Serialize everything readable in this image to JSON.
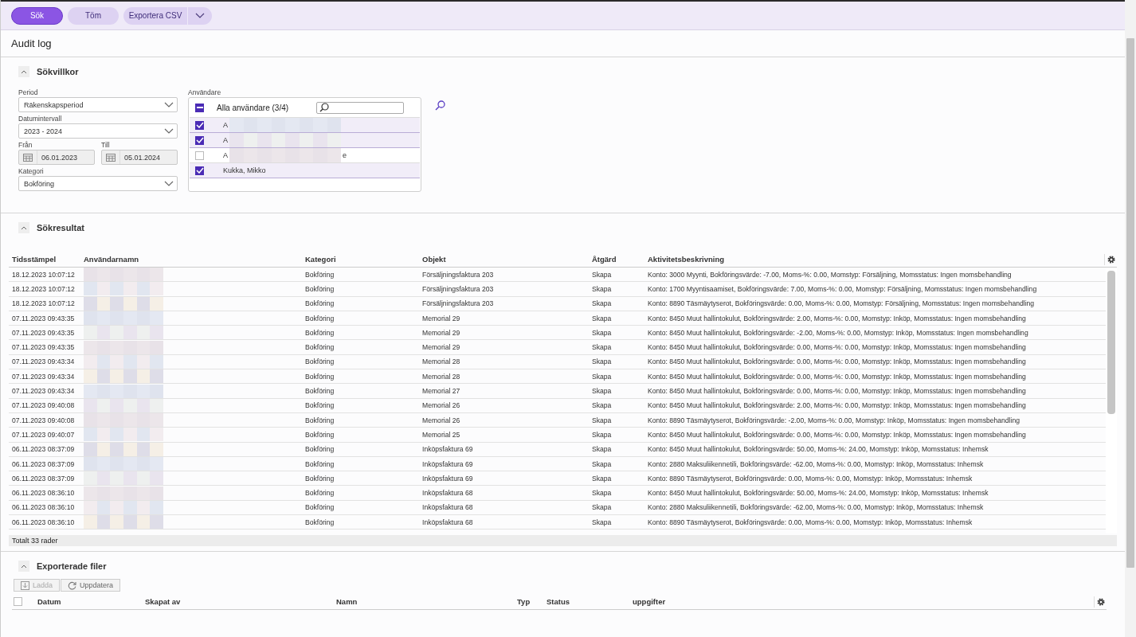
{
  "toolbar": {
    "buttons": [
      {
        "label": "Sök",
        "kind": "primary"
      },
      {
        "label": "Töm",
        "kind": "secondary"
      },
      {
        "label": "Exportera CSV",
        "kind": "split"
      }
    ]
  },
  "page_title": "Audit log",
  "criteria": {
    "title": "Sökvillkor",
    "expanded": true,
    "period": {
      "label": "Period",
      "value": "Räkenskapsperiod"
    },
    "date_range": {
      "label": "Datumintervall",
      "value": "2023 - 2024"
    },
    "from": {
      "label": "Från",
      "value": "06.01.2023"
    },
    "to": {
      "label": "Till",
      "value": "05.01.2024"
    },
    "category": {
      "label": "Kategori",
      "value": "Bokföring"
    },
    "users": {
      "label": "Användare",
      "header": "Alla användare (3/4)",
      "indeterminate": true,
      "items": [
        {
          "label_start": "A",
          "redacted": true,
          "checked": true
        },
        {
          "label_start": "A",
          "redacted": true,
          "checked": true
        },
        {
          "label_start": "A",
          "label_end": "e",
          "redacted": true,
          "checked": false
        },
        {
          "label_start": "Kukka, Mikko",
          "redacted": false,
          "checked": true
        }
      ]
    }
  },
  "results": {
    "title": "Sökresultat",
    "expanded": true,
    "columns": [
      "Tidsstämpel",
      "Användarnamn",
      "Kategori",
      "Objekt",
      "Åtgärd",
      "Aktivitetsbeskrivning"
    ],
    "rows": [
      {
        "timestamp": "18.12.2023 10:07:12",
        "user_redacted": true,
        "category": "Bokföring",
        "object": "Försäljningsfaktura 203",
        "action": "Skapa",
        "description": "Konto: 3000 Myynti, Bokföringsvärde: -7.00, Moms-%: 0.00, Momstyp: Försäljning, Momsstatus: Ingen momsbehandling"
      },
      {
        "timestamp": "18.12.2023 10:07:12",
        "user_redacted": true,
        "category": "Bokföring",
        "object": "Försäljningsfaktura 203",
        "action": "Skapa",
        "description": "Konto: 1700 Myyntisaamiset, Bokföringsvärde: 7.00, Moms-%: 0.00, Momstyp: Försäljning, Momsstatus: Ingen momsbehandling"
      },
      {
        "timestamp": "18.12.2023 10:07:12",
        "user_redacted": true,
        "category": "Bokföring",
        "object": "Försäljningsfaktura 203",
        "action": "Skapa",
        "description": "Konto: 8890 Täsmäytyserot, Bokföringsvärde: 0.00, Moms-%: 0.00, Momstyp: Försäljning, Momsstatus: Ingen momsbehandling"
      },
      {
        "timestamp": "07.11.2023 09:43:35",
        "user_redacted": true,
        "category": "Bokföring",
        "object": "Memorial 29",
        "action": "Skapa",
        "description": "Konto: 8450 Muut hallintokulut, Bokföringsvärde: 2.00, Moms-%: 0.00, Momstyp: Inköp, Momsstatus: Ingen momsbehandling"
      },
      {
        "timestamp": "07.11.2023 09:43:35",
        "user_redacted": true,
        "category": "Bokföring",
        "object": "Memorial 29",
        "action": "Skapa",
        "description": "Konto: 8450 Muut hallintokulut, Bokföringsvärde: -2.00, Moms-%: 0.00, Momstyp: Inköp, Momsstatus: Ingen momsbehandling"
      },
      {
        "timestamp": "07.11.2023 09:43:35",
        "user_redacted": true,
        "category": "Bokföring",
        "object": "Memorial 29",
        "action": "Skapa",
        "description": "Konto: 8450 Muut hallintokulut, Bokföringsvärde: 0.00, Moms-%: 0.00, Momstyp: Inköp, Momsstatus: Ingen momsbehandling"
      },
      {
        "timestamp": "07.11.2023 09:43:34",
        "user_redacted": true,
        "category": "Bokföring",
        "object": "Memorial 28",
        "action": "Skapa",
        "description": "Konto: 8450 Muut hallintokulut, Bokföringsvärde: 0.00, Moms-%: 0.00, Momstyp: Inköp, Momsstatus: Ingen momsbehandling"
      },
      {
        "timestamp": "07.11.2023 09:43:34",
        "user_redacted": true,
        "category": "Bokföring",
        "object": "Memorial 28",
        "action": "Skapa",
        "description": "Konto: 8450 Muut hallintokulut, Bokföringsvärde: 0.00, Moms-%: 0.00, Momstyp: Inköp, Momsstatus: Ingen momsbehandling"
      },
      {
        "timestamp": "07.11.2023 09:43:34",
        "user_redacted": true,
        "category": "Bokföring",
        "object": "Memorial 27",
        "action": "Skapa",
        "description": "Konto: 8450 Muut hallintokulut, Bokföringsvärde: 0.00, Moms-%: 0.00, Momstyp: Inköp, Momsstatus: Ingen momsbehandling"
      },
      {
        "timestamp": "07.11.2023 09:40:08",
        "user_redacted": true,
        "category": "Bokföring",
        "object": "Memorial 26",
        "action": "Skapa",
        "description": "Konto: 8450 Muut hallintokulut, Bokföringsvärde: 2.00, Moms-%: 0.00, Momstyp: Inköp, Momsstatus: Ingen momsbehandling"
      },
      {
        "timestamp": "07.11.2023 09:40:08",
        "user_redacted": true,
        "category": "Bokföring",
        "object": "Memorial 26",
        "action": "Skapa",
        "description": "Konto: 8890 Täsmäytyserot, Bokföringsvärde: -2.00, Moms-%: 0.00, Momstyp: Inköp, Momsstatus: Ingen momsbehandling"
      },
      {
        "timestamp": "07.11.2023 09:40:07",
        "user_redacted": true,
        "category": "Bokföring",
        "object": "Memorial 25",
        "action": "Skapa",
        "description": "Konto: 8450 Muut hallintokulut, Bokföringsvärde: 0.00, Moms-%: 0.00, Momstyp: Inköp, Momsstatus: Ingen momsbehandling"
      },
      {
        "timestamp": "06.11.2023 08:37:09",
        "user_redacted": true,
        "category": "Bokföring",
        "object": "Inköpsfaktura 69",
        "action": "Skapa",
        "description": "Konto: 8450 Muut hallintokulut, Bokföringsvärde: 50.00, Moms-%: 24.00, Momstyp: Inköp, Momsstatus: Inhemsk"
      },
      {
        "timestamp": "06.11.2023 08:37:09",
        "user_redacted": true,
        "category": "Bokföring",
        "object": "Inköpsfaktura 69",
        "action": "Skapa",
        "description": "Konto: 2880 Maksuliikennetili, Bokföringsvärde: -62.00, Moms-%: 0.00, Momstyp: Inköp, Momsstatus: Inhemsk"
      },
      {
        "timestamp": "06.11.2023 08:37:09",
        "user_redacted": true,
        "category": "Bokföring",
        "object": "Inköpsfaktura 69",
        "action": "Skapa",
        "description": "Konto: 8890 Täsmäytyserot, Bokföringsvärde: 0.00, Moms-%: 0.00, Momstyp: Inköp, Momsstatus: Inhemsk"
      },
      {
        "timestamp": "06.11.2023 08:36:10",
        "user_redacted": true,
        "category": "Bokföring",
        "object": "Inköpsfaktura 68",
        "action": "Skapa",
        "description": "Konto: 8450 Muut hallintokulut, Bokföringsvärde: 50.00, Moms-%: 24.00, Momstyp: Inköp, Momsstatus: Inhemsk"
      },
      {
        "timestamp": "06.11.2023 08:36:10",
        "user_redacted": true,
        "category": "Bokföring",
        "object": "Inköpsfaktura 68",
        "action": "Skapa",
        "description": "Konto: 2880 Maksuliikennetili, Bokföringsvärde: -62.00, Moms-%: 0.00, Momstyp: Inköp, Momsstatus: Inhemsk"
      },
      {
        "timestamp": "06.11.2023 08:36:10",
        "user_redacted": true,
        "category": "Bokföring",
        "object": "Inköpsfaktura 68",
        "action": "Skapa",
        "description": "Konto: 8890 Täsmäytyserot, Bokföringsvärde: 0.00, Moms-%: 0.00, Momstyp: Inköp, Momsstatus: Inhemsk"
      }
    ],
    "footer": "Totalt 33 rader"
  },
  "exports": {
    "title": "Exporterade filer",
    "expanded": true,
    "select_all_checked": false,
    "buttons": [
      {
        "label": "Ladda",
        "kind": "download",
        "disabled": true
      },
      {
        "label": "Uppdatera",
        "kind": "refresh",
        "disabled": false
      }
    ],
    "columns": [
      "Datum",
      "Skapat av",
      "Namn",
      "Typ",
      "Status",
      "uppgifter"
    ]
  }
}
